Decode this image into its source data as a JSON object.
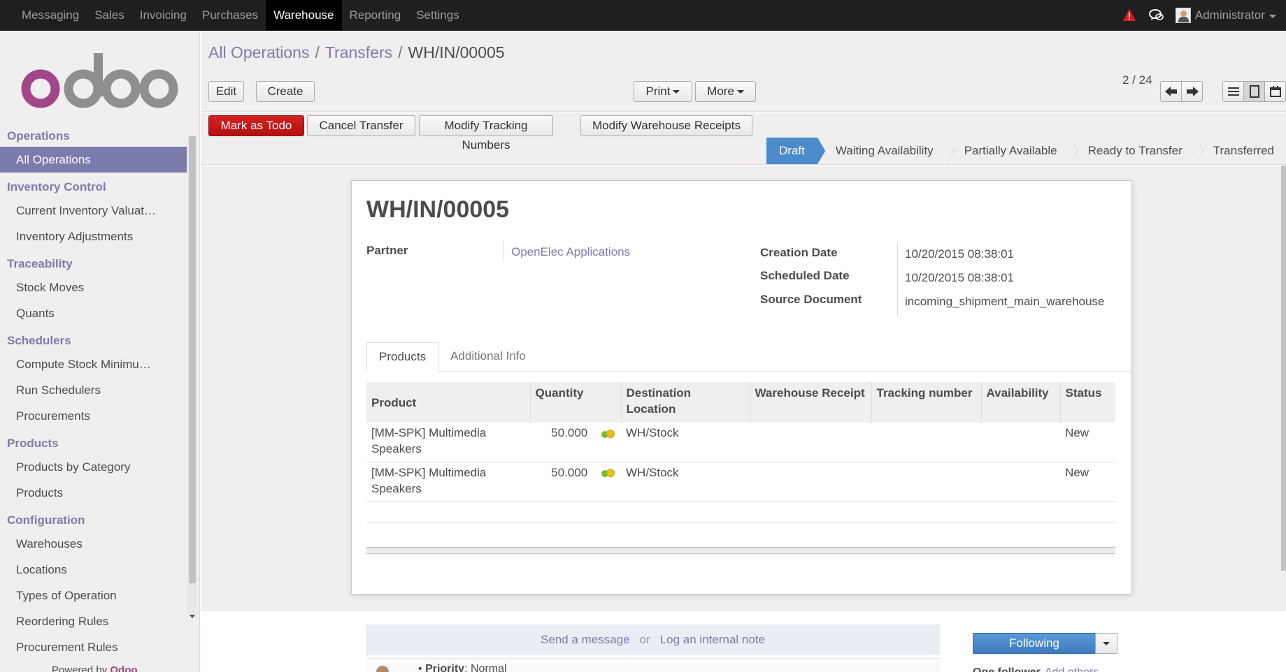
{
  "topbar": {
    "menu": [
      "Messaging",
      "Sales",
      "Invoicing",
      "Purchases",
      "Warehouse",
      "Reporting",
      "Settings"
    ],
    "active_menu": "Warehouse",
    "user_name": "Administrator",
    "icons": {
      "alert": "alert-triangle-icon",
      "chat": "chat-bubbles-icon"
    }
  },
  "sidebar": {
    "logo": "odoo",
    "sections": [
      {
        "title": "Operations",
        "items": [
          "All Operations"
        ]
      },
      {
        "title": "Inventory Control",
        "items": [
          "Current Inventory Valuat…",
          "Inventory Adjustments"
        ]
      },
      {
        "title": "Traceability",
        "items": [
          "Stock Moves",
          "Quants"
        ]
      },
      {
        "title": "Schedulers",
        "items": [
          "Compute Stock Minimu…",
          "Run Schedulers",
          "Procurements"
        ]
      },
      {
        "title": "Products",
        "items": [
          "Products by Category",
          "Products"
        ]
      },
      {
        "title": "Configuration",
        "items": [
          "Warehouses",
          "Locations",
          "Types of Operation",
          "Reordering Rules",
          "Procurement Rules"
        ]
      }
    ],
    "active_item": "All Operations",
    "powered_by": "Powered by",
    "powered_brand": "Odoo"
  },
  "breadcrumb": {
    "items": [
      "All Operations",
      "Transfers"
    ],
    "separator": "/",
    "current": "WH/IN/00005"
  },
  "buttons": {
    "edit": "Edit",
    "create": "Create",
    "print": "Print",
    "more": "More"
  },
  "pager": {
    "counter": "2 / 24"
  },
  "status_buttons": {
    "mark_todo": "Mark as Todo",
    "cancel_transfer": "Cancel Transfer",
    "modify_tracking": "Modify Tracking Numbers",
    "modify_receipts": "Modify Warehouse Receipts"
  },
  "stages": [
    "Draft",
    "Waiting Availability",
    "Partially Available",
    "Ready to Transfer",
    "Transferred"
  ],
  "current_stage": "Draft",
  "record": {
    "title": "WH/IN/00005",
    "partner_label": "Partner",
    "partner_value": "OpenElec Applications",
    "creation_date_label": "Creation Date",
    "creation_date_value": "10/20/2015 08:38:01",
    "scheduled_date_label": "Scheduled Date",
    "scheduled_date_value": "10/20/2015 08:38:01",
    "source_document_label": "Source Document",
    "source_document_value": "incoming_shipment_main_warehouse"
  },
  "tabs": [
    "Products",
    "Additional Info"
  ],
  "active_tab": "Products",
  "table": {
    "headers": {
      "product": "Product",
      "quantity": "Quantity",
      "destination_1": "Destination",
      "destination_2": "Location",
      "warehouse_receipt": "Warehouse Receipt",
      "tracking": "Tracking number",
      "availability": "Availability",
      "status": "Status"
    },
    "rows": [
      {
        "product_1": "[MM-SPK] Multimedia",
        "product_2": "Speakers",
        "quantity": "50.000",
        "destination": "WH/Stock",
        "warehouse_receipt": "",
        "tracking": "",
        "availability": "",
        "status": "New"
      },
      {
        "product_1": "[MM-SPK] Multimedia",
        "product_2": "Speakers",
        "quantity": "50.000",
        "destination": "WH/Stock",
        "warehouse_receipt": "",
        "tracking": "",
        "availability": "",
        "status": "New"
      }
    ]
  },
  "chatter": {
    "send_message": "Send a message",
    "or": "or",
    "log_note": "Log an internal note",
    "following": "Following",
    "followers_label": "One follower",
    "add_others": "Add others",
    "message_bullet": "•",
    "message_field": "Priority",
    "message_value": ": Normal"
  }
}
